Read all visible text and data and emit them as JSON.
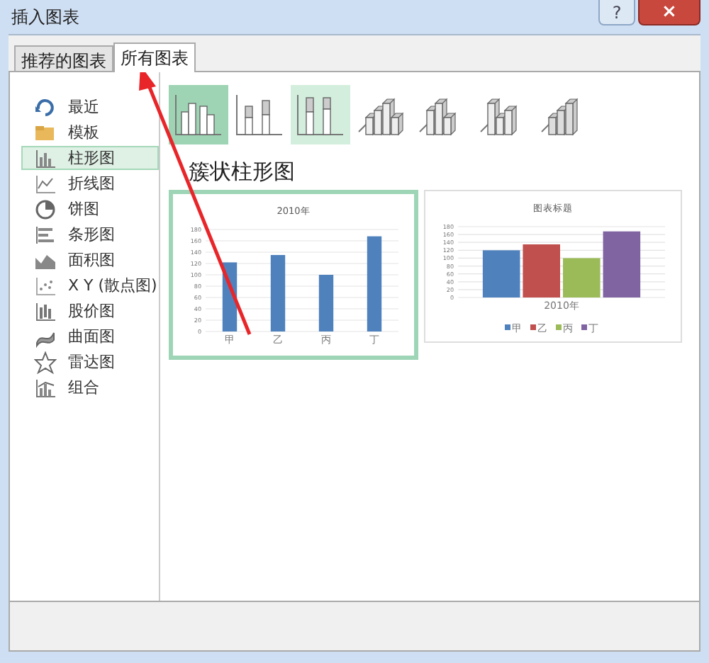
{
  "window": {
    "title": "插入图表",
    "help_button": "?",
    "close_button": "×"
  },
  "tabs": [
    {
      "label": "推荐的图表",
      "selected": false
    },
    {
      "label": "所有图表",
      "selected": true
    }
  ],
  "sidebar": {
    "items": [
      {
        "label": "最近",
        "selected": false
      },
      {
        "label": "模板",
        "selected": false
      },
      {
        "label": "柱形图",
        "selected": true
      },
      {
        "label": "折线图",
        "selected": false
      },
      {
        "label": "饼图",
        "selected": false
      },
      {
        "label": "条形图",
        "selected": false
      },
      {
        "label": "面积图",
        "selected": false
      },
      {
        "label": "X Y (散点图)",
        "selected": false
      },
      {
        "label": "股价图",
        "selected": false
      },
      {
        "label": "曲面图",
        "selected": false
      },
      {
        "label": "雷达图",
        "selected": false
      },
      {
        "label": "组合",
        "selected": false
      }
    ]
  },
  "subtypes": [
    {
      "selected": true,
      "hover": false
    },
    {
      "selected": false,
      "hover": false
    },
    {
      "selected": false,
      "hover": true
    },
    {
      "selected": false,
      "hover": false
    },
    {
      "selected": false,
      "hover": false
    },
    {
      "selected": false,
      "hover": false
    },
    {
      "selected": false,
      "hover": false
    }
  ],
  "heading": "簇状柱形图",
  "previews": [
    {
      "selected": true,
      "chart_data": {
        "type": "bar",
        "grid": true,
        "title": "2010年",
        "categories": [
          "甲",
          "乙",
          "丙",
          "丁"
        ],
        "ylim": [
          0,
          180
        ],
        "yticks": [
          0,
          20,
          40,
          60,
          80,
          100,
          120,
          140,
          160,
          180
        ],
        "series": [
          {
            "color": "#4f81bd",
            "values": [
              122,
              135,
              100,
              168
            ]
          }
        ]
      }
    },
    {
      "selected": false,
      "chart_data": {
        "type": "bar",
        "grid": true,
        "legend": true,
        "title": "图表标题",
        "categories": [
          "2010年"
        ],
        "ylim": [
          0,
          180
        ],
        "yticks": [
          0,
          20,
          40,
          60,
          80,
          100,
          120,
          140,
          160,
          180
        ],
        "series": [
          {
            "name": "甲",
            "color": "#4f81bd",
            "values": [
              120
            ]
          },
          {
            "name": "乙",
            "color": "#c0504d",
            "values": [
              135
            ]
          },
          {
            "name": "丙",
            "color": "#9bbb59",
            "values": [
              100
            ]
          },
          {
            "name": "丁",
            "color": "#8064a2",
            "values": [
              168
            ]
          }
        ]
      }
    }
  ]
}
